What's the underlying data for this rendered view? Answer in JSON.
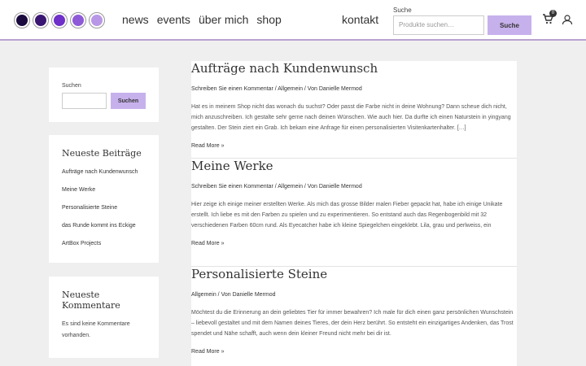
{
  "header": {
    "logo_dots": [
      "#1a0a3d",
      "#3a1673",
      "#6f2fc9",
      "#8e5ad8",
      "#b897e6"
    ],
    "nav": [
      "news",
      "events",
      "über mich",
      "shop"
    ],
    "kontakt": "kontakt",
    "search_label": "Suche",
    "search_placeholder": "Produkte suchen…",
    "search_button": "Suche",
    "cart_count": "0"
  },
  "sidebar": {
    "search_label": "Suchen",
    "search_button": "Suchen",
    "recent_title": "Neueste Beiträge",
    "recent_items": [
      "Aufträge nach Kundenwunsch",
      "Meine Werke",
      "Personalisierte Steine",
      "das Runde kommt ins Eckige",
      "ArtBox Projects"
    ],
    "comments_title": "Neueste Kommentare",
    "comments_text": "Es sind keine Kommentare vorhanden."
  },
  "posts": [
    {
      "title": "Aufträge nach Kundenwunsch",
      "meta": "Schreiben Sie einen Kommentar / Allgemein / Von Danielle Mermod",
      "excerpt": "Hat es in meinem Shop nicht das wonach du suchst? Oder passt die Farbe nicht in deine Wohnung? Dann scheue dich nicht, mich anzuschreiben. Ich gestalte sehr gerne nach deinen Wünschen. Wie auch hier. Da durfte ich einen Naturstein in yingyang gestalten. Der Stein ziert ein Grab. Ich bekam eine Anfrage für einen personalisierten Visitenkartenhalter. […]",
      "read_more": "Read More »"
    },
    {
      "title": "Meine Werke",
      "meta": "Schreiben Sie einen Kommentar / Allgemein / Von Danielle Mermod",
      "excerpt": "Hier zeige ich einige meiner erstellten Werke. Als mich das grosse Bilder malen Fieber gepackt hat, habe ich einige Unikate erstellt. Ich liebe es mit den Farben zu spielen und zu experimentieren. So entstand auch das Regenbogenbild mit 32 verschiedenen Farben 60cm rund. Als Eyecatcher habe ich kleine Spiegelchen eingeklebt. Lila, grau und perlweiss, ein",
      "read_more": "Read More »"
    },
    {
      "title": "Personalisierte Steine",
      "meta": "Allgemein / Von Danielle Mermod",
      "excerpt": "Möchtest du die Erinnerung an dein geliebtes Tier für immer bewahren? Ich male für dich einen ganz persönlichen Wunschstein – liebevoll gestaltet und mit dem Namen deines Tieres, der dein Herz berührt. So entsteht ein einzigartiges Andenken, das Trost spendet und Nähe schafft, auch wenn dein kleiner Freund nicht mehr bei dir ist.",
      "read_more": "Read More »"
    }
  ]
}
